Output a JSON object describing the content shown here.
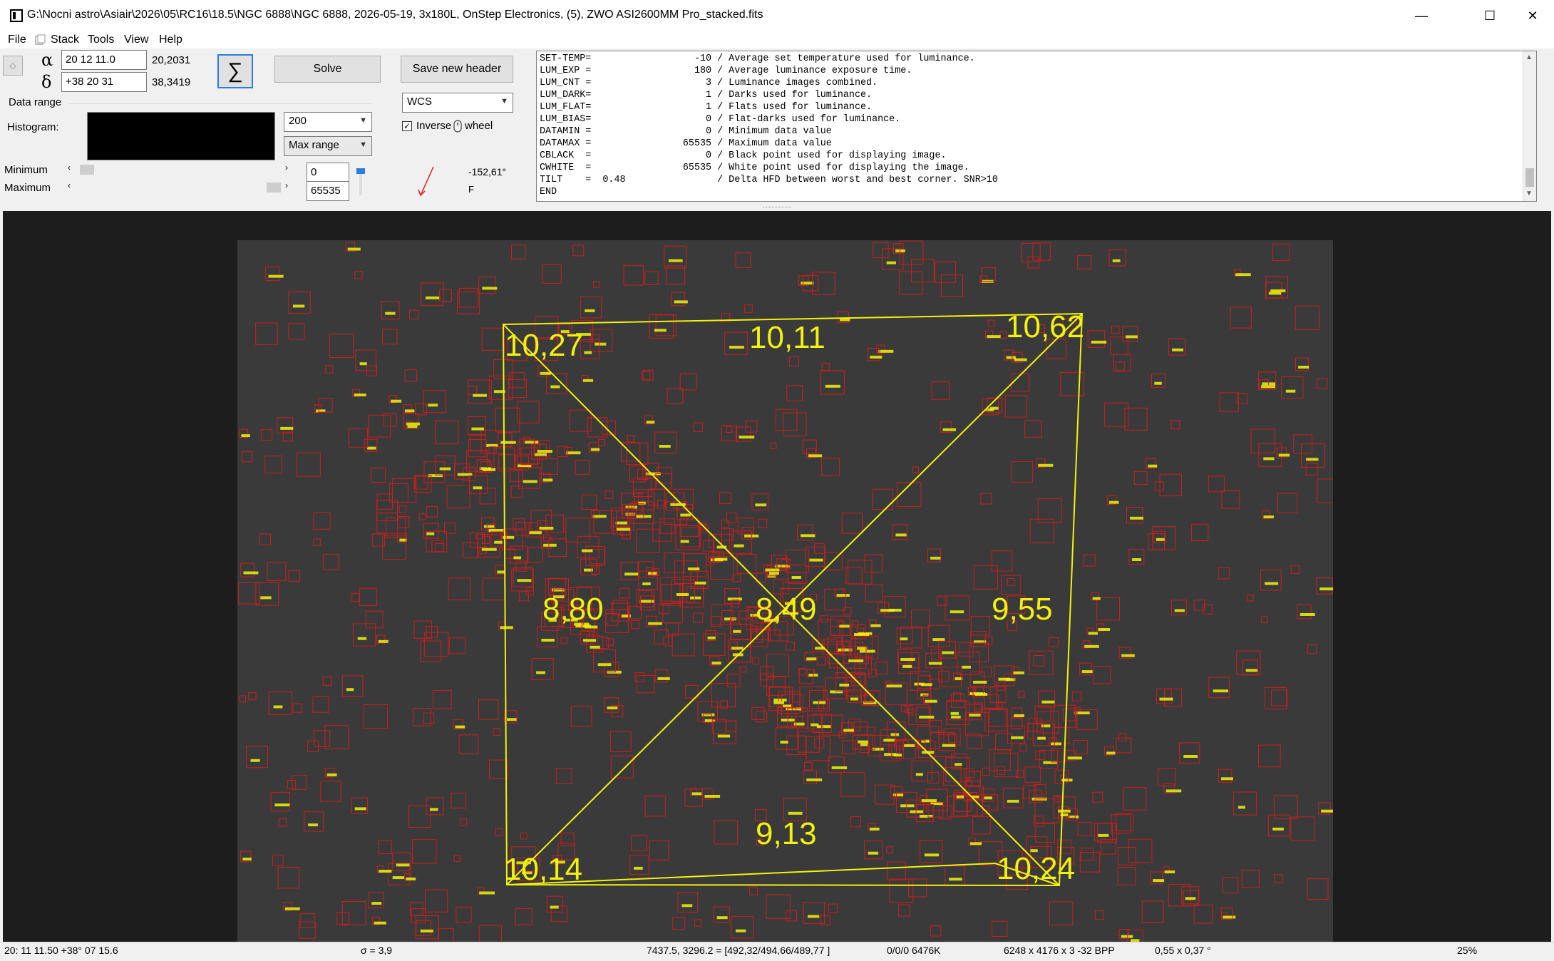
{
  "window": {
    "title": "G:\\Nocni astro\\Asiair\\2026\\05\\RC16\\18.5\\NGC 6888\\NGC 6888, 2026-05-19, 3x180L, OnStep Electronics, (5), ZWO ASI2600MM Pro_stacked.fits",
    "minimize_glyph": "—",
    "maximize_glyph": "☐",
    "close_glyph": "✕"
  },
  "menu": [
    "File",
    "Stack",
    "Tools",
    "View",
    "Help"
  ],
  "coords": {
    "alpha_symbol": "α",
    "delta_symbol": "δ",
    "ra_value": "20 12 11.0",
    "dec_value": "+38 20 31",
    "ra_decimal": "20,2031",
    "dec_decimal": "38,3419"
  },
  "buttons": {
    "sigma": "∑",
    "solve": "Solve",
    "save_header": "Save new header"
  },
  "data_range": {
    "group_label": "Data range",
    "histogram_label": "Histogram:",
    "level_value": "200",
    "range_mode": "Max range",
    "minimum_label": "Minimum",
    "maximum_label": "Maximum",
    "minimum_value": "0",
    "maximum_value": "65535"
  },
  "wcs": {
    "mode": "WCS",
    "inverse_label": "Inverse",
    "wheel_label": "wheel",
    "angle": "-152,61°",
    "f_label": "F"
  },
  "header_lines": [
    "SET-TEMP=                  -10 / Average set temperature used for luminance.",
    "LUM_EXP =                  180 / Average luminance exposure time.",
    "LUM_CNT =                    3 / Luminance images combined.",
    "LUM_DARK=                    1 / Darks used for luminance.",
    "LUM_FLAT=                    1 / Flats used for luminance.",
    "LUM_BIAS=                    0 / Flat-darks used for luminance.",
    "DATAMIN =                    0 / Minimum data value",
    "DATAMAX =                65535 / Maximum data value",
    "CBLACK  =                    0 / Black point used for displaying image.",
    "CWHITE  =                65535 / White point used for displaying the image.",
    "TILT    =  0.48                / Delta HFD between worst and best corner. SNR>10",
    "END"
  ],
  "hfd_labels": {
    "top_left": "10,27",
    "top_center": "10,11",
    "top_right": "10,62",
    "mid_left": "8,80",
    "center": "8,49",
    "mid_right": "9,55",
    "bottom_left": "10,14",
    "bottom_center": "9,13",
    "bottom_right": "10,24"
  },
  "colors": {
    "overlay_yellow": "#f2f20a",
    "star_box_red": "#c8201e",
    "background": "#3a3a3a"
  },
  "status": {
    "cursor_coords": "20: 11  11.50  +38° 07  15.6",
    "sigma": "σ = 3,9",
    "pixel_info": "7437.5, 3296.2 = [492,32/494,66/489,77 ]",
    "flags": "0/0/0  6476K",
    "dimensions": "6248 x 4176 x 3   -32 BPP",
    "scale": "0,55 x 0,37 °",
    "zoom": "25%"
  },
  "icons": {
    "app": "app-icon",
    "scroll_up": "▲",
    "scroll_down": "▼"
  }
}
